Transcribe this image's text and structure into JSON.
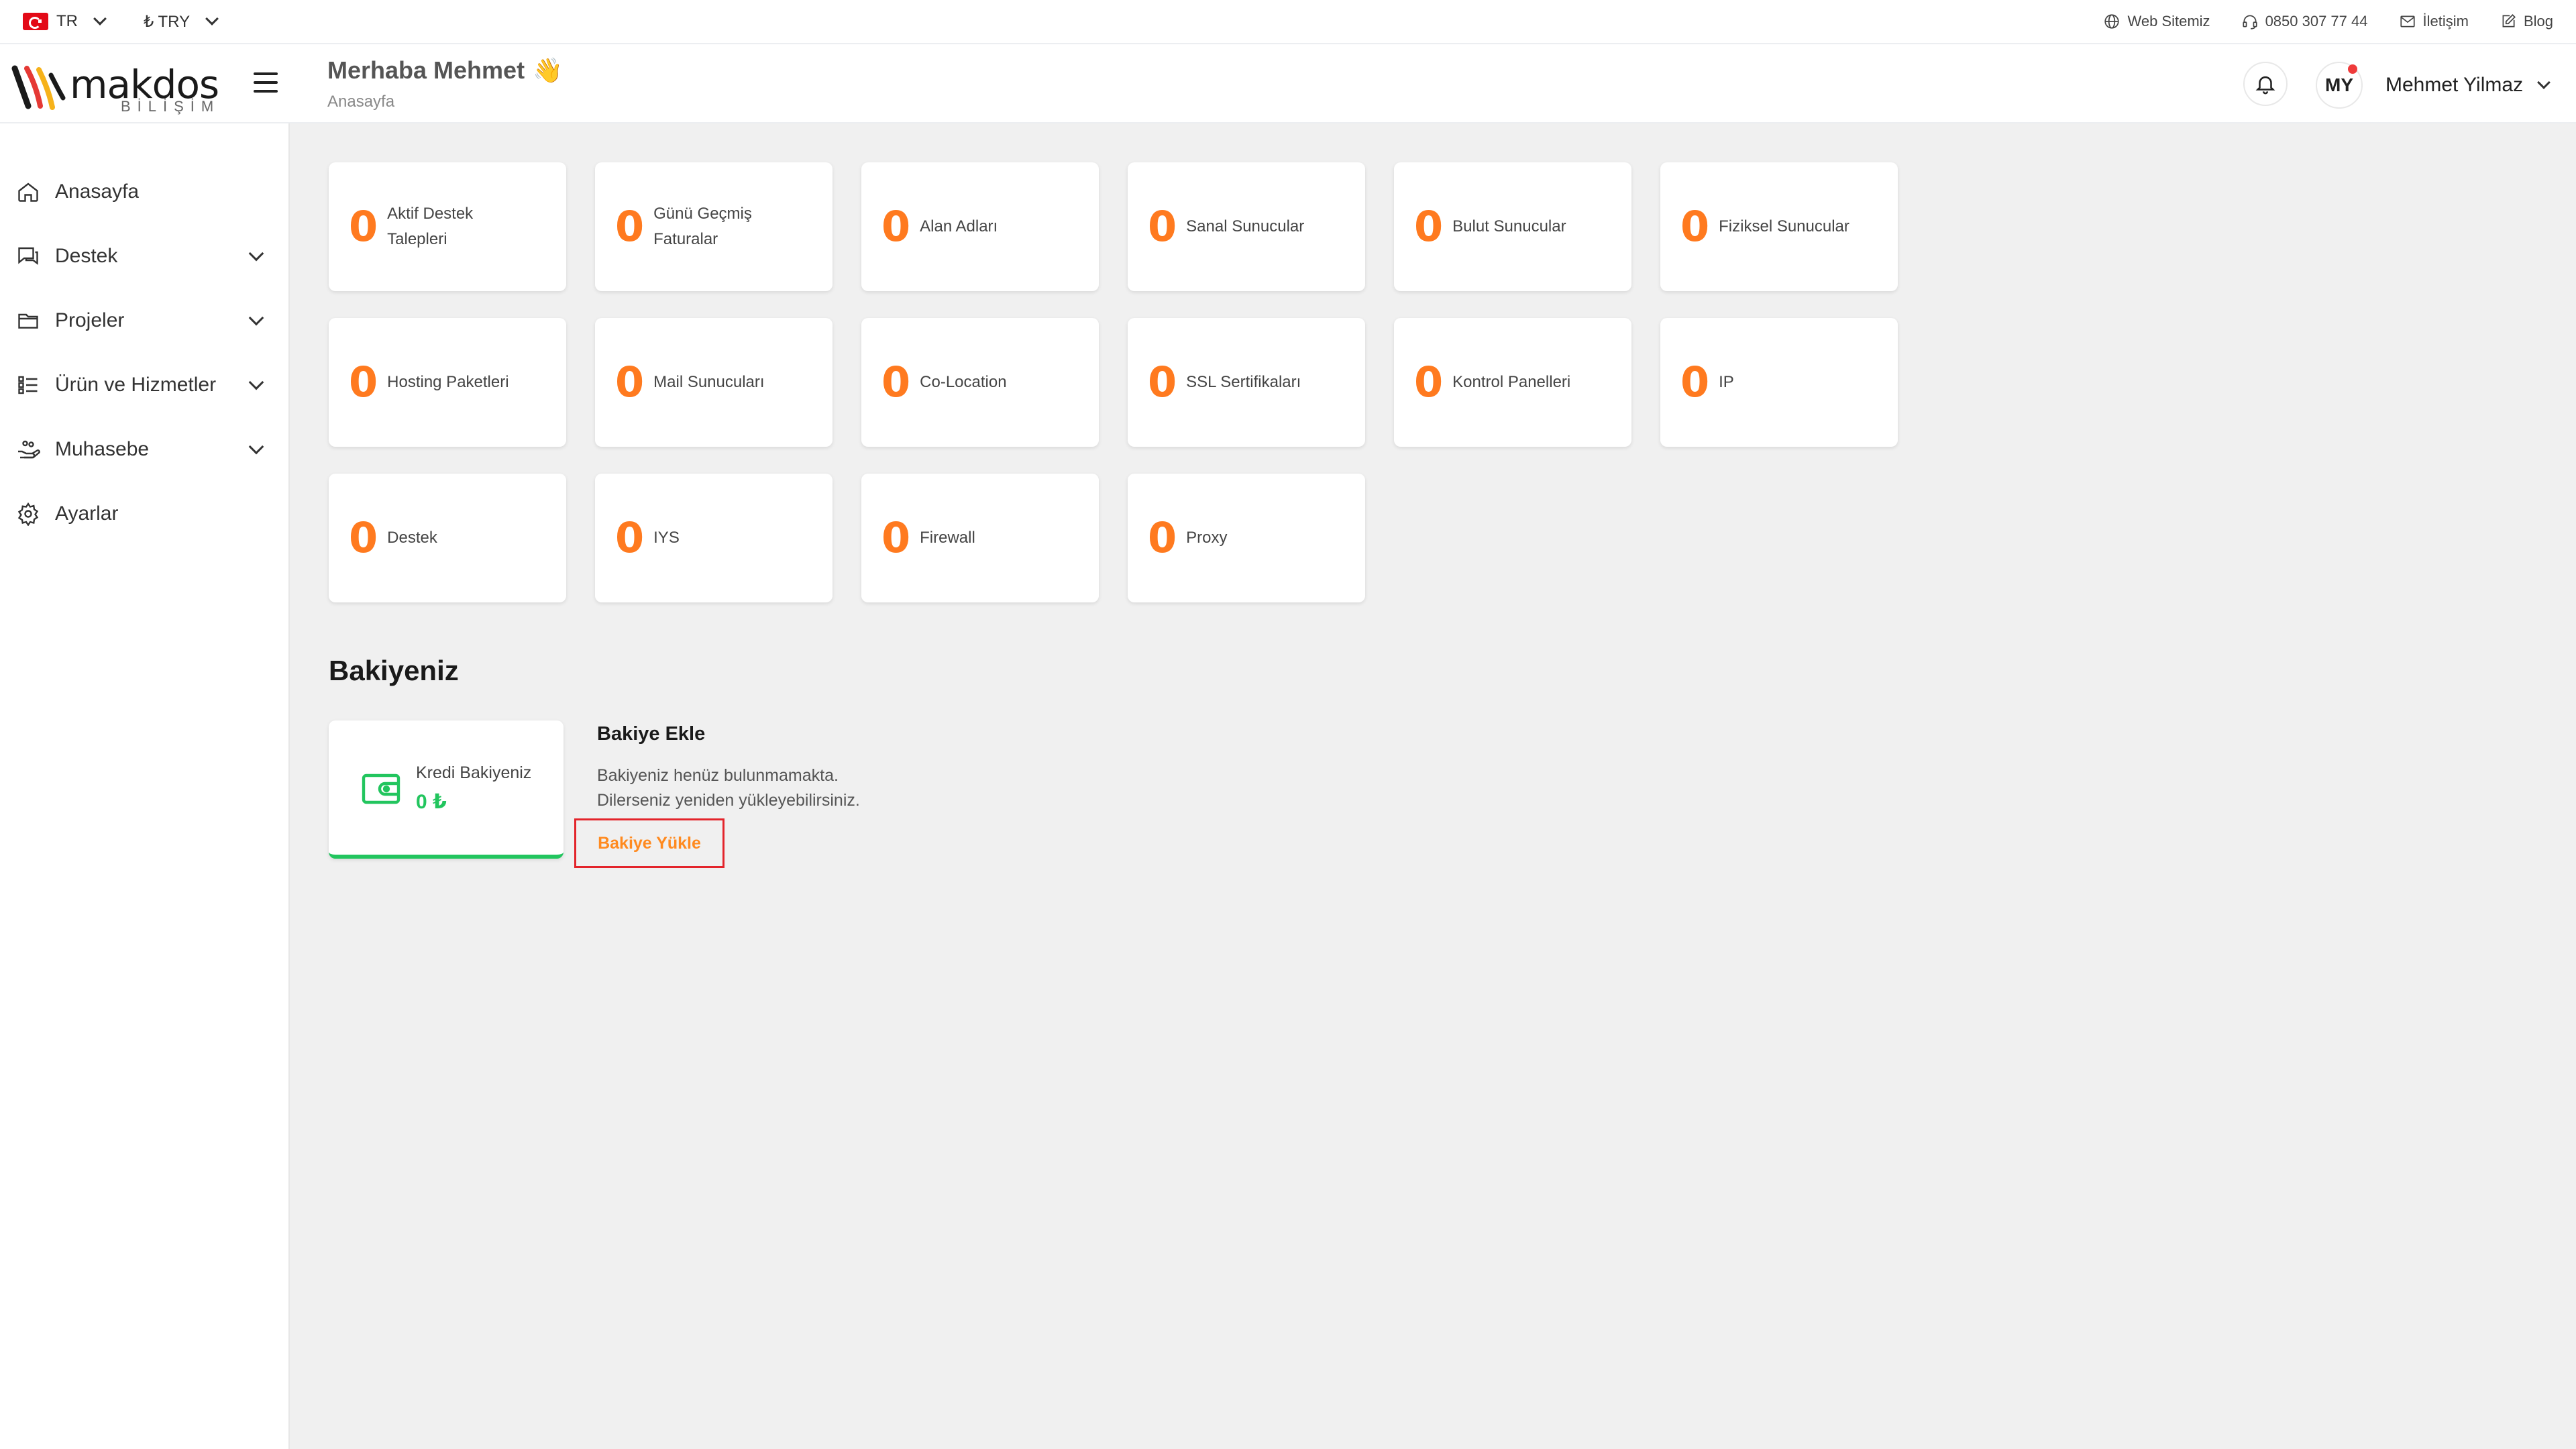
{
  "topbar": {
    "language": "TR",
    "currency": "₺ TRY",
    "links": [
      {
        "label": "Web Sitemiz",
        "icon": "globe-icon"
      },
      {
        "label": "0850 307 77 44",
        "icon": "headset-icon"
      },
      {
        "label": "İletişim",
        "icon": "mail-icon"
      },
      {
        "label": "Blog",
        "icon": "edit-icon"
      }
    ]
  },
  "header": {
    "logo_text": "makdos",
    "logo_sub": "BİLİŞİM",
    "greeting": "Merhaba Mehmet",
    "greeting_emoji": "👋",
    "breadcrumb": "Anasayfa",
    "avatar_initials": "MY",
    "user_name": "Mehmet Yilmaz"
  },
  "sidebar": {
    "items": [
      {
        "label": "Anasayfa",
        "icon": "home-icon"
      },
      {
        "label": "Destek",
        "icon": "chat-icon"
      },
      {
        "label": "Projeler",
        "icon": "folder-icon"
      },
      {
        "label": "Ürün ve Hizmetler",
        "icon": "list-icon"
      },
      {
        "label": "Muhasebe",
        "icon": "hand-money-icon"
      },
      {
        "label": "Ayarlar",
        "icon": "gear-icon"
      }
    ]
  },
  "stats": [
    {
      "value": "0",
      "label": "Aktif Destek Talepleri"
    },
    {
      "value": "0",
      "label": "Günü Geçmiş Faturalar"
    },
    {
      "value": "0",
      "label": "Alan Adları"
    },
    {
      "value": "0",
      "label": "Sanal Sunucular"
    },
    {
      "value": "0",
      "label": "Bulut Sunucular"
    },
    {
      "value": "0",
      "label": "Fiziksel Sunucular"
    },
    {
      "value": "0",
      "label": "Hosting Paketleri"
    },
    {
      "value": "0",
      "label": "Mail Sunucuları"
    },
    {
      "value": "0",
      "label": "Co-Location"
    },
    {
      "value": "0",
      "label": "SSL Sertifikaları"
    },
    {
      "value": "0",
      "label": "Kontrol Panelleri"
    },
    {
      "value": "0",
      "label": "IP"
    },
    {
      "value": "0",
      "label": "Destek"
    },
    {
      "value": "0",
      "label": "IYS"
    },
    {
      "value": "0",
      "label": "Firewall"
    },
    {
      "value": "0",
      "label": "Proxy"
    }
  ],
  "balance": {
    "title": "Bakiyeniz",
    "credit_label": "Kredi Bakiyeniz",
    "credit_value": "0 ₺",
    "add_title": "Bakiye Ekle",
    "add_text_1": "Bakiyeniz henüz bulunmamakta.",
    "add_text_2": "Dilerseniz yeniden yükleyebilirsiniz.",
    "add_button": "Bakiye Yükle"
  },
  "colors": {
    "accent_orange": "#ff7a1f",
    "success_green": "#22c55e",
    "highlight_red": "#e3242b"
  }
}
